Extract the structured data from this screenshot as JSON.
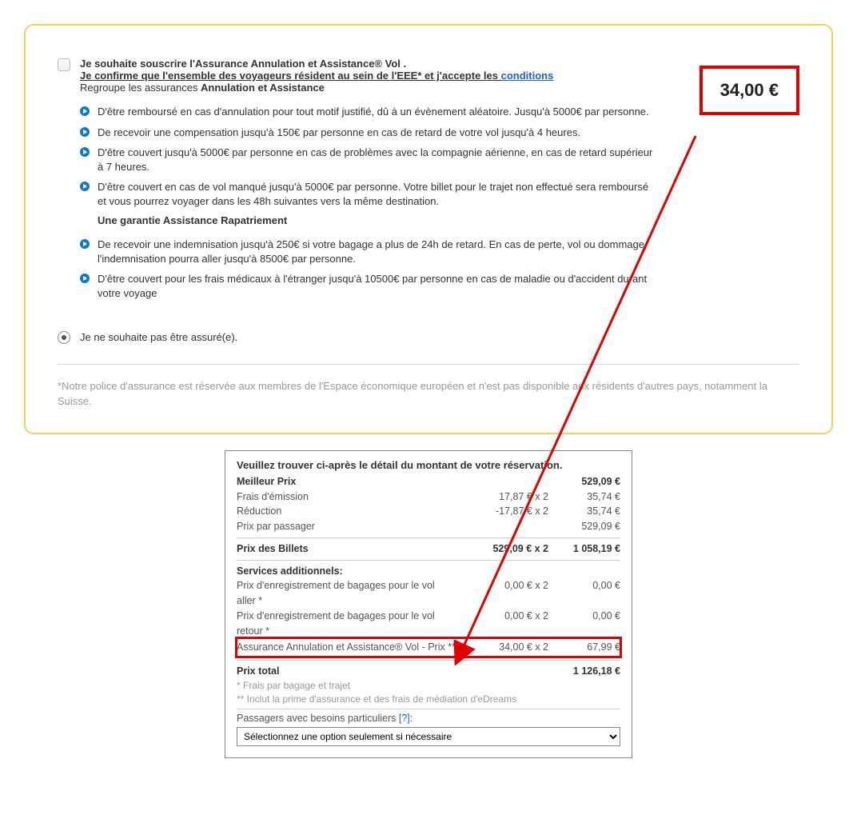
{
  "insurance": {
    "line1": "Je souhaite souscrire l'Assurance Annulation et Assistance® Vol .",
    "line2_prefix": "Je confirme que l'ensemble des voyageurs résident au sein de l'EEE* et j'accepte les ",
    "conditions_label": "conditions",
    "subtitle_prefix": "Regroupe les assurances ",
    "subtitle_bold": "Annulation et Assistance",
    "price": "34,00 €",
    "bullets1": [
      "D'être remboursé en cas d'annulation pour tout motif justifié, dû à un évènement aléatoire. Jusqu'à 5000€ par personne.",
      "De recevoir une compensation jusqu'à 150€ par personne en cas de retard de votre vol jusqu'à 4 heures.",
      "D'être couvert jusqu'à 5000€ par personne en cas de problèmes avec la compagnie aérienne, en cas de retard supérieur à 7 heures.",
      "D'être couvert en cas de vol manqué jusqu'à 5000€ par personne. Votre billet pour le trajet non effectué sera remboursé et vous pourrez voyager dans les 48h suivantes vers la même destination."
    ],
    "sub_guarantee": "Une garantie Assistance Rapatriement",
    "bullets2": [
      "De recevoir une indemnisation jusqu'à 250€ si votre bagage a plus de 24h de retard. En cas de perte, vol ou dommage, l'indemnisation pourra aller jusqu'à 8500€ par personne.",
      "D'être couvert pour les frais médicaux à l'étranger jusqu'à 10500€ par personne en cas de maladie ou d'accident durant votre voyage"
    ],
    "decline_label": "Je ne souhaite pas être assuré(e).",
    "footnote": "*Notre police d'assurance est réservée aux membres de l'Espace économique européen et n'est pas disponible aux résidents d'autres pays, notamment la Suisse."
  },
  "summary": {
    "title": "Veuillez trouver ci-après le détail du montant de votre réservation.",
    "rows": {
      "best_price": {
        "label": "Meilleur Prix",
        "mid": "",
        "tot": "529,09 €"
      },
      "emission": {
        "label": "Frais d'émission",
        "mid": "17,87 € x 2",
        "tot": "35,74 €"
      },
      "reduction": {
        "label": "Réduction",
        "mid": "-17,87 € x 2",
        "tot": "35,74 €"
      },
      "per_pax": {
        "label": "Prix par passager",
        "mid": "",
        "tot": "529,09 €"
      },
      "tickets": {
        "label": "Prix des Billets",
        "mid": "529,09 € x 2",
        "tot": "1 058,19 €"
      },
      "add_services": {
        "label": "Services additionnels:"
      },
      "bag_out": {
        "label": "Prix d'enregistrement de bagages pour le vol aller *",
        "mid": "0,00 € x 2",
        "tot": "0,00 €"
      },
      "bag_ret": {
        "label": "Prix d'enregistrement de bagages pour le vol retour *",
        "mid": "0,00 € x 2",
        "tot": "0,00 €"
      },
      "insurance_row": {
        "label": "Assurance Annulation et Assistance® Vol  - Prix **",
        "mid": "34,00 € x 2",
        "tot": "67,99 €"
      },
      "total": {
        "label": "Prix total",
        "mid": "",
        "tot": "1 126,18 €"
      }
    },
    "note1": "* Frais par bagage et trajet",
    "note2": "** Inclut la prime d'assurance et des frais de médiation d'eDreams",
    "pax_label": "Passagers avec besoins particuliers ",
    "pax_help": "[?]",
    "pax_colon": ":",
    "select_placeholder": "Sélectionnez une option seulement si nécessaire"
  }
}
